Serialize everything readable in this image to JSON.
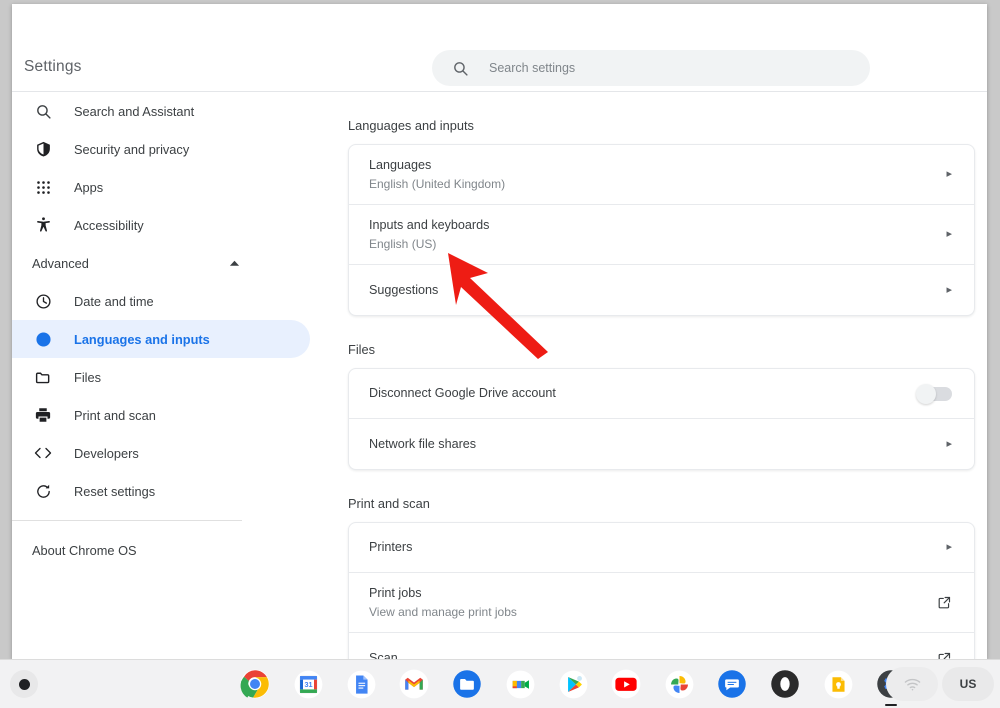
{
  "window": {
    "app_title": "Settings"
  },
  "search": {
    "placeholder": "Search settings",
    "value": "",
    "icon": "search-icon"
  },
  "sidebar": {
    "items": [
      {
        "label": "Search and Assistant",
        "icon": "search-icon",
        "selected": false
      },
      {
        "label": "Security and privacy",
        "icon": "shield-icon",
        "selected": false
      },
      {
        "label": "Apps",
        "icon": "apps-grid-icon",
        "selected": false
      },
      {
        "label": "Accessibility",
        "icon": "accessibility-person-icon",
        "selected": false
      }
    ],
    "advanced_group": {
      "label": "Advanced",
      "expanded": true,
      "icon": "chevron-up-icon"
    },
    "advanced_items": [
      {
        "label": "Date and time",
        "icon": "clock-icon",
        "selected": false
      },
      {
        "label": "Languages and inputs",
        "icon": "globe-icon",
        "selected": true
      },
      {
        "label": "Files",
        "icon": "folder-icon",
        "selected": false
      },
      {
        "label": "Print and scan",
        "icon": "printer-icon",
        "selected": false
      },
      {
        "label": "Developers",
        "icon": "code-brackets-icon",
        "selected": false
      },
      {
        "label": "Reset settings",
        "icon": "reset-refresh-icon",
        "selected": false
      }
    ],
    "about": {
      "label": "About Chrome OS"
    }
  },
  "main": {
    "sections": [
      {
        "title": "Languages and inputs",
        "rows": [
          {
            "title": "Languages",
            "sub": "English (United Kingdom)",
            "control": "chevron"
          },
          {
            "title": "Inputs and keyboards",
            "sub": "English (US)",
            "control": "chevron"
          },
          {
            "title": "Suggestions",
            "sub": "",
            "control": "chevron"
          }
        ]
      },
      {
        "title": "Files",
        "rows": [
          {
            "title": "Disconnect Google Drive account",
            "sub": "",
            "control": "toggle",
            "toggle_on": false
          },
          {
            "title": "Network file shares",
            "sub": "",
            "control": "chevron"
          }
        ]
      },
      {
        "title": "Print and scan",
        "rows": [
          {
            "title": "Printers",
            "sub": "",
            "control": "chevron"
          },
          {
            "title": "Print jobs",
            "sub": "View and manage print jobs",
            "control": "external"
          },
          {
            "title": "Scan",
            "sub": "",
            "control": "external"
          }
        ]
      }
    ]
  },
  "annotation": {
    "arrow_color": "#ee1c14",
    "name": "red-pointer-arrow",
    "points_to": "Inputs and keyboards"
  },
  "shelf": {
    "launcher": {
      "name": "launcher-button"
    },
    "apps": [
      {
        "name": "chrome-icon",
        "label": "Chrome"
      },
      {
        "name": "google-calendar-icon",
        "label": "Calendar"
      },
      {
        "name": "google-docs-icon",
        "label": "Docs"
      },
      {
        "name": "gmail-icon",
        "label": "Gmail"
      },
      {
        "name": "files-app-icon",
        "label": "Files"
      },
      {
        "name": "google-meet-icon",
        "label": "Meet"
      },
      {
        "name": "google-play-icon",
        "label": "Play Store"
      },
      {
        "name": "youtube-icon",
        "label": "YouTube"
      },
      {
        "name": "google-photos-icon",
        "label": "Photos"
      },
      {
        "name": "google-messages-icon",
        "label": "Messages"
      },
      {
        "name": "opera-icon",
        "label": "Opera"
      },
      {
        "name": "google-keep-icon",
        "label": "Keep"
      },
      {
        "name": "settings-gear-icon",
        "label": "Settings"
      }
    ],
    "status": {
      "network_icon": "wifi-icon",
      "input_method": "US"
    }
  },
  "colors": {
    "accent": "#1a73e8",
    "selected_bg": "#e8f0fe",
    "text_primary": "#3c4043",
    "text_secondary": "#80868b",
    "card_border": "#e8eaed",
    "annotation_red": "#ee1c14"
  }
}
